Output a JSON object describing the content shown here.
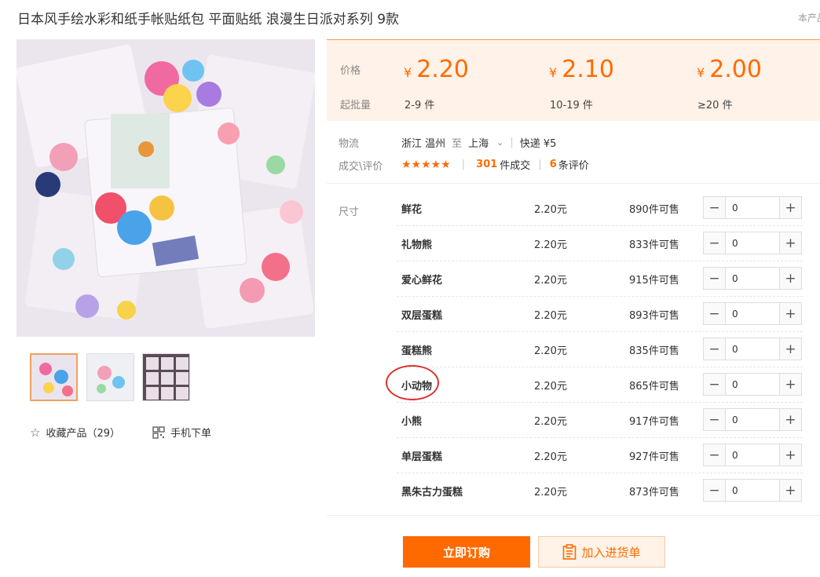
{
  "header": {
    "title": "日本风手绘水彩和纸手帐贴纸包 平面贴纸 浪漫生日派对系列 9款",
    "notice": "本产品"
  },
  "gallery": {
    "actions": {
      "favorite_label": "收藏产品（29）",
      "mobile_label": "手机下单"
    }
  },
  "price_box": {
    "price_label": "价格",
    "moq_label": "起批量",
    "currency": "¥",
    "tiers": [
      {
        "price": "2.20",
        "range": "2-9 件"
      },
      {
        "price": "2.10",
        "range": "10-19 件"
      },
      {
        "price": "2.00",
        "range": "≥20 件"
      }
    ]
  },
  "logistics": {
    "label": "物流",
    "from": "浙江 温州",
    "to_word": "至",
    "to": "上海",
    "shipping": "快递 ¥5"
  },
  "deals": {
    "label": "成交\\评价",
    "stars": "★★★★★",
    "rating": 5,
    "sold_count": "301",
    "sold_suffix": "件成交",
    "review_count": "6",
    "review_suffix": "条评价"
  },
  "sku": {
    "label": "尺寸",
    "rows": [
      {
        "name": "鲜花",
        "price": "2.20元",
        "stock": "890件可售",
        "qty": "0"
      },
      {
        "name": "礼物熊",
        "price": "2.20元",
        "stock": "833件可售",
        "qty": "0"
      },
      {
        "name": "爱心鲜花",
        "price": "2.20元",
        "stock": "915件可售",
        "qty": "0"
      },
      {
        "name": "双层蛋糕",
        "price": "2.20元",
        "stock": "893件可售",
        "qty": "0"
      },
      {
        "name": "蛋糕熊",
        "price": "2.20元",
        "stock": "835件可售",
        "qty": "0"
      },
      {
        "name": "小动物",
        "price": "2.20元",
        "stock": "865件可售",
        "qty": "0"
      },
      {
        "name": "小熊",
        "price": "2.20元",
        "stock": "917件可售",
        "qty": "0"
      },
      {
        "name": "单层蛋糕",
        "price": "2.20元",
        "stock": "927件可售",
        "qty": "0"
      },
      {
        "name": "黑朱古力蛋糕",
        "price": "2.20元",
        "stock": "873件可售",
        "qty": "0"
      }
    ]
  },
  "buttons": {
    "buy": "立即订购",
    "cart": "加入进货单"
  },
  "colors": {
    "accent": "#ff6a00",
    "price_bg": "#fff2e8",
    "annotation": "#e03030"
  }
}
